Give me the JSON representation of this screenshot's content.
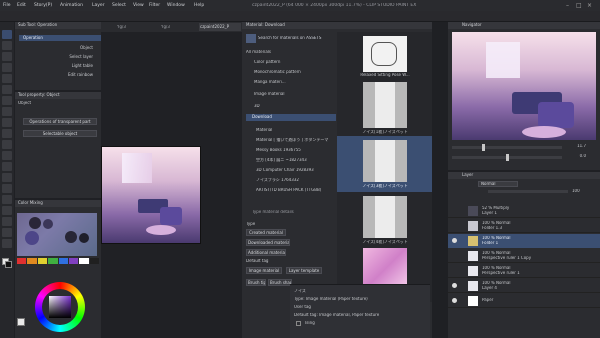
{
  "menu": {
    "items": [
      "File",
      "Edit",
      "Story(P)",
      "Animation",
      "Layer",
      "Select",
      "View",
      "Filter",
      "Window",
      "Help"
    ],
    "title": "czpaint2022_P (64 000 × 2400px 300dpi 11.7%) - CLIP STUDIO PAINT EX"
  },
  "tabs": {
    "left": [
      "Sub Tool: Operation"
    ],
    "canvas_tabs": [
      "Yg/3",
      "Yg/3",
      "czpaint2022_P"
    ]
  },
  "subtool": {
    "header": "Sub Tool: Operation",
    "items": [
      "Operation",
      "Object",
      "Select layer",
      "Light table",
      "Edit rainbow"
    ],
    "selected": "Operation"
  },
  "tool_property": {
    "header": "Tool property: Object",
    "label": "Object",
    "dropdown1": "Operations of transparent part",
    "dropdown2": "Selectable object"
  },
  "color": {
    "header": "Color Mixing",
    "swatch_colors": [
      "#e03030",
      "#e08a20",
      "#e0d030",
      "#40b040",
      "#3070e0",
      "#8040c0",
      "#ffffff",
      "#202020"
    ]
  },
  "material_panel": {
    "title": "Material: Download",
    "search": "Search for materials on ASSETS",
    "tree": [
      {
        "label": "All materials",
        "indent": 0
      },
      {
        "label": "Color pattern",
        "indent": 1
      },
      {
        "label": "Monochromatic pattern",
        "indent": 1
      },
      {
        "label": "Manga materi...",
        "indent": 1
      },
      {
        "label": "Image material",
        "indent": 1
      },
      {
        "label": "3D",
        "indent": 1
      },
      {
        "label": "Download",
        "indent": 0,
        "selected": true
      },
      {
        "label": "Material",
        "indent": 1
      },
      {
        "label": "Material [ 描いて遊ぼう ] ボタンテーマ",
        "indent": 1
      },
      {
        "label": "Messy Books 1936755",
        "indent": 1
      },
      {
        "label": "空方 [4本] 展ニ ~1827343",
        "indent": 1
      },
      {
        "label": "3D Computer Chair 1928393",
        "indent": 1
      },
      {
        "label": "ノイズブラシ 1764332",
        "indent": 1
      },
      {
        "label": "ARTIST/TD BRUSH PACK (TTGBB)",
        "indent": 1
      }
    ],
    "thumbs": [
      {
        "label": "Relaxed Sitting Pose W..."
      },
      {
        "label": "ノイズ[1枚]ノイズペット"
      },
      {
        "label": "ノイズ[3枚]ノイズペット"
      },
      {
        "label": "ノイズ[4枚]ノイズペット"
      },
      {
        "label": "Pastine"
      }
    ],
    "info_title": "Type material details",
    "type_label": "Type",
    "buttons": [
      "Created material",
      "Downloaded material",
      "Additional materials"
    ],
    "default_tag_label": "Default tag",
    "tag_buttons": [
      "Image material",
      "Layer template"
    ],
    "tabs": [
      "Brush tips",
      "Brush shape"
    ],
    "details": [
      "ノイズ",
      "Type: Image material (Paper texture)",
      "User tag",
      "Default tag: Image material, Paper texture",
      "Tiling"
    ]
  },
  "navigator": {
    "header": "Navigator",
    "zoom": "11.7",
    "angle": "0.0"
  },
  "layers": {
    "header": "Layer",
    "blend": "Normal",
    "opacity": "100",
    "items": [
      {
        "name": "52 % Multiply",
        "sub": "Layer 1"
      },
      {
        "name": "100 % Normal",
        "sub": "Folder 1.3"
      },
      {
        "name": "100 % Normal",
        "sub": "Folder 1",
        "selected": true
      },
      {
        "name": "100 % Normal",
        "sub": "Perspective ruler 1 Copy"
      },
      {
        "name": "100 % Normal",
        "sub": "Perspective ruler 1"
      },
      {
        "name": "100 % Normal",
        "sub": "Layer 4"
      },
      {
        "name": "",
        "sub": "Paper"
      }
    ]
  }
}
